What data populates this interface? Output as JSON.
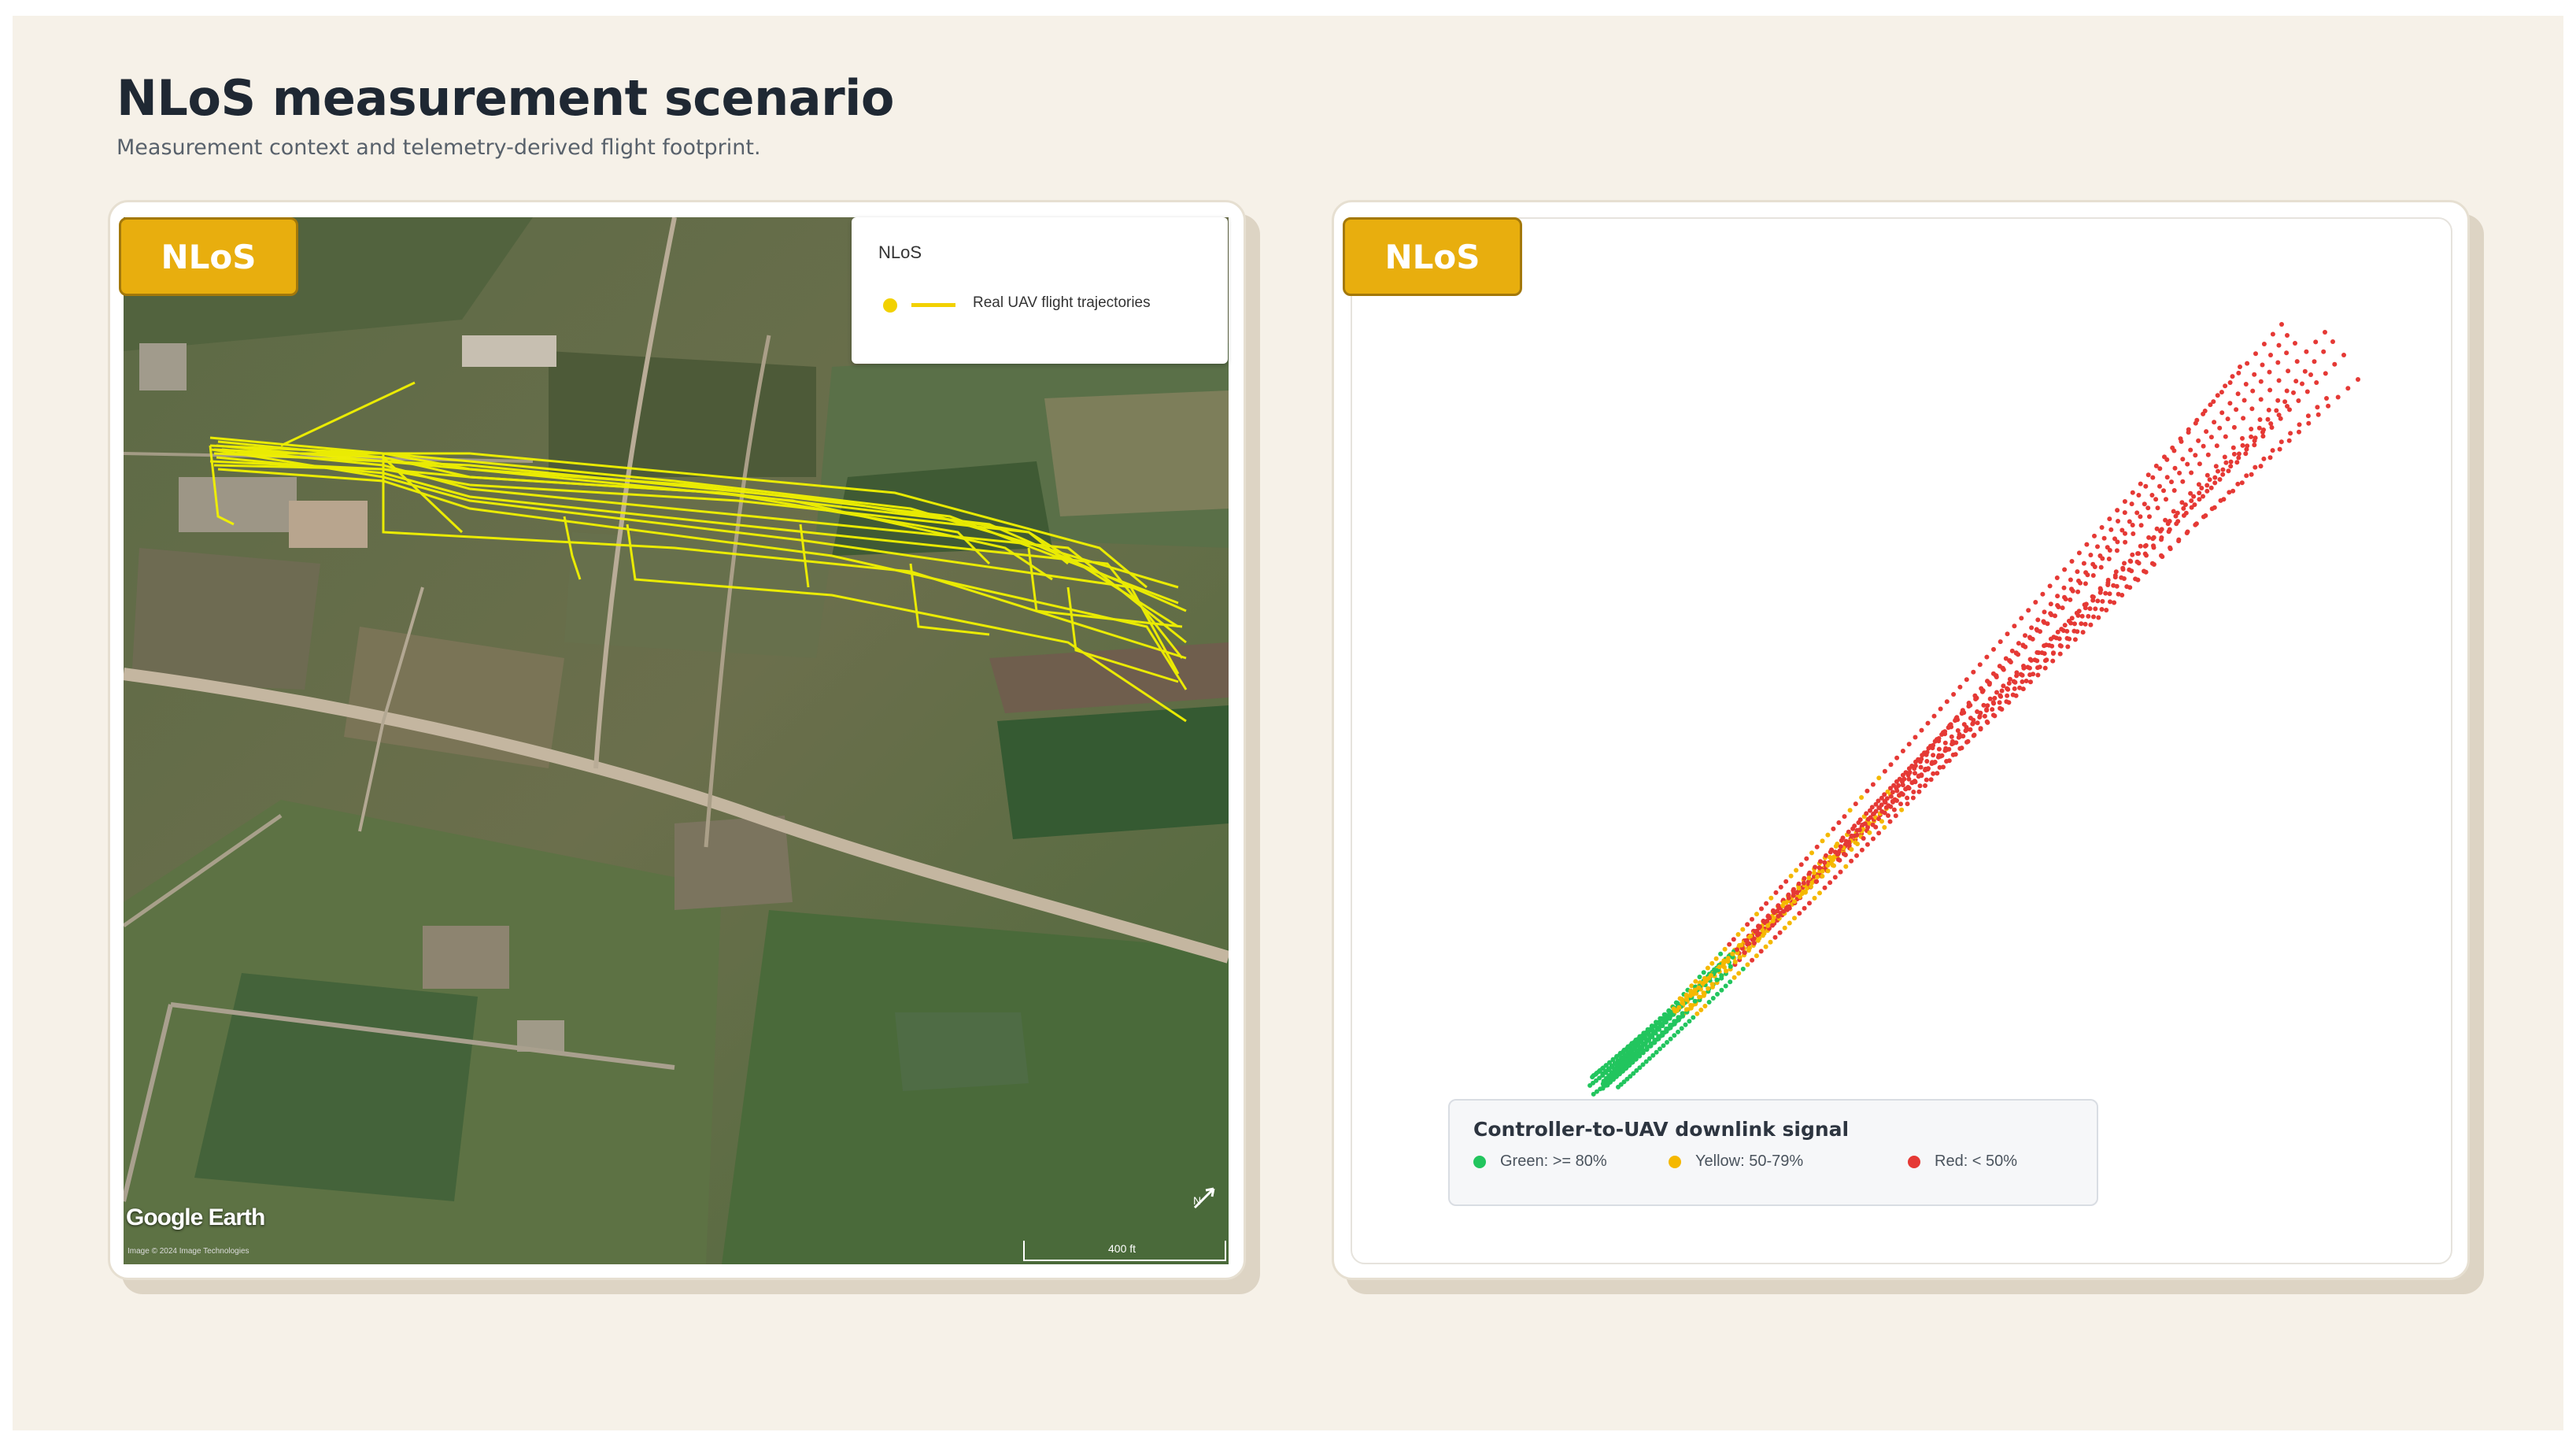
{
  "header": {
    "title": "NLoS measurement scenario",
    "subtitle": "Measurement context and telemetry-derived flight footprint."
  },
  "left_panel": {
    "badge": "NLoS",
    "legend": {
      "title": "NLoS",
      "item_label": "Real UAV flight trajectories",
      "item_color": "#f2d100"
    },
    "map": {
      "logo": "Google Earth",
      "credit": "Image © 2024 Image Technologies",
      "scale": "400 ft",
      "compass_icon": "north-arrow-icon"
    }
  },
  "right_panel": {
    "badge": "NLoS",
    "legend": {
      "title": "Controller-to-UAV downlink signal",
      "items": [
        {
          "label": "Green: >= 80%",
          "color": "#22c55e"
        },
        {
          "label": "Yellow: 50-79%",
          "color": "#f5b800"
        },
        {
          "label": "Red: < 50%",
          "color": "#e53935"
        }
      ]
    }
  },
  "colors": {
    "background": "#f6f1e8",
    "badge": "#e8ae0e",
    "trajectory": "#f2d100",
    "green": "#22c55e",
    "yellow": "#f5b800",
    "red": "#e53935"
  }
}
